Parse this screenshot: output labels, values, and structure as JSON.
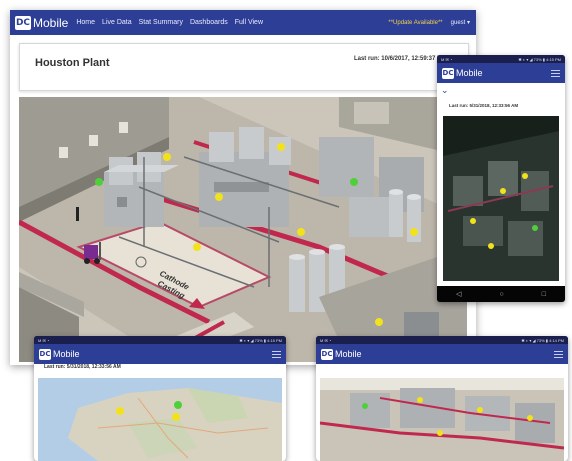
{
  "app": {
    "logo_badge": "DC",
    "logo_text": "Mobile",
    "nav_items": [
      "Home",
      "Live Data",
      "Stat Summary",
      "Dashboards",
      "Full View"
    ],
    "update_notice": "**Update Available**",
    "user_menu": "guest ▾"
  },
  "desktop": {
    "page_title": "Houston Plant",
    "last_run": "Last run: 10/6/2017, 12:59:37 PM",
    "scene_caption_line1": "Cathode",
    "scene_caption_line2": "Casting"
  },
  "phone_tall": {
    "status_left": "M ✉ ◔",
    "status_right": "✱ ◐ ▾ ◢ 73% ▮ 4:15 PM",
    "logo_badge": "DC",
    "logo_text": "Mobile",
    "collapse_icon": "chevron-down-icon",
    "last_run": "Last run: 5/31/2018, 12:33:56 AM",
    "nav_back": "◁",
    "nav_home": "○",
    "nav_recent": "□"
  },
  "phone_map": {
    "status_left": "M ✉ ◔",
    "status_right": "✱ ◐ ▾ ◢ 73% ▮ 4:15 PM",
    "logo_badge": "DC",
    "logo_text": "Mobile",
    "last_run": "Last run: 5/31/2018, 12:33:56 AM"
  },
  "phone_plant": {
    "status_left": "M ✉ ◔",
    "status_right": "✱ ◐ ▾ ◢ 73% ▮ 4:14 PM",
    "logo_badge": "DC",
    "logo_text": "Mobile"
  },
  "colors": {
    "navbar": "#2d3e96",
    "status_bar": "#1a1f4d",
    "update_text": "#f6d24a",
    "conveyor_red": "#c0284e",
    "indicator_yellow": "#f2e21b",
    "indicator_green": "#4fcf3a"
  }
}
